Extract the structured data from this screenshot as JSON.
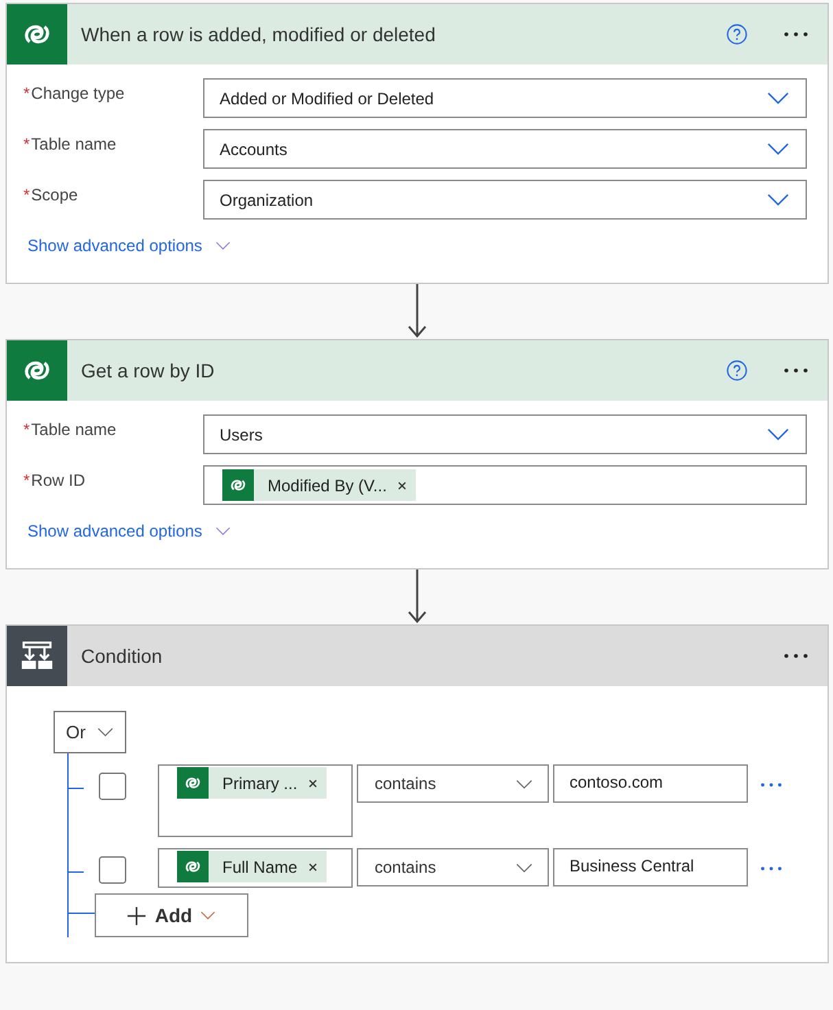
{
  "steps": [
    {
      "kind": "trigger",
      "title": "When a row is added, modified or deleted",
      "help": true,
      "fields": [
        {
          "label": "Change type",
          "marker": "*",
          "kind": "dropdown",
          "value": "Added or Modified or Deleted"
        },
        {
          "label": "Table name",
          "marker": "*",
          "kind": "dropdown",
          "value": "Accounts"
        },
        {
          "label": "Scope",
          "marker": "*",
          "kind": "dropdown",
          "value": "Organization"
        }
      ],
      "advanced": "Show advanced options"
    },
    {
      "kind": "action",
      "title": "Get a row by ID",
      "help": true,
      "fields": [
        {
          "label": "Table name",
          "marker": "*",
          "kind": "dropdown",
          "value": "Users"
        },
        {
          "label": "Row ID",
          "marker": "*",
          "kind": "token",
          "value": "Modified By (V..."
        }
      ],
      "advanced": "Show advanced options"
    },
    {
      "kind": "condition",
      "title": "Condition",
      "help": false,
      "group_operator": "Or",
      "rows": [
        {
          "checked": false,
          "token": "Primary ...",
          "operator": "contains",
          "value": "contoso.com",
          "tall": true
        },
        {
          "checked": false,
          "token": "Full Name",
          "operator": "contains",
          "value": "Business Central",
          "tall": false
        }
      ],
      "add_button": "Add"
    }
  ]
}
